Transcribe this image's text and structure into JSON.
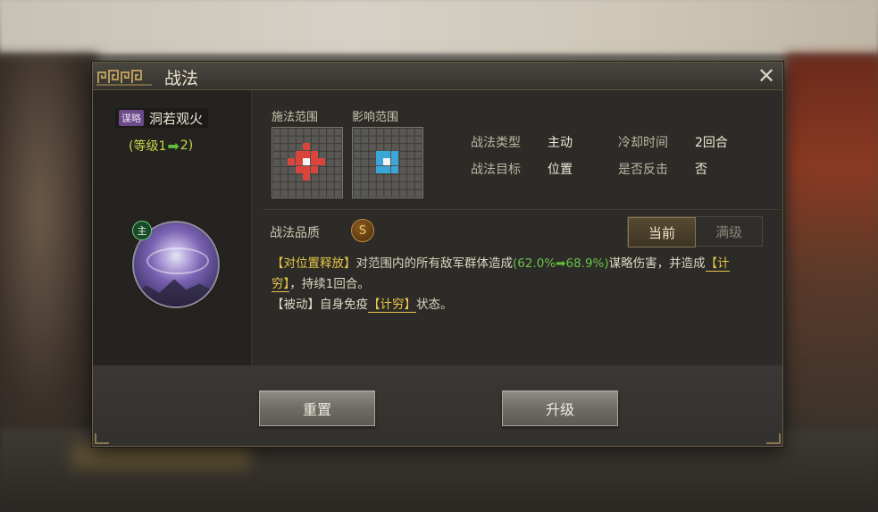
{
  "dialog": {
    "title": "战法",
    "close_symbol": "✕"
  },
  "skill": {
    "type_badge": "谋略",
    "name": "洞若观火",
    "level_prefix": "(等级1",
    "level_arrow": "➡",
    "level_suffix": "2)",
    "role_badge": "主"
  },
  "range": {
    "cast_label": "施法范围",
    "effect_label": "影响范围"
  },
  "stats": {
    "type_label": "战法类型",
    "type_value": "主动",
    "target_label": "战法目标",
    "target_value": "位置",
    "cooldown_label": "冷却时间",
    "cooldown_value": "2回合",
    "counter_label": "是否反击",
    "counter_value": "否"
  },
  "quality": {
    "label": "战法品质",
    "grade": "S"
  },
  "toggle": {
    "current": "当前",
    "max": "满级"
  },
  "description": {
    "p1_tag": "【对位置释放】",
    "p1_text_a": "对范围内的所有敌军群体造成",
    "p1_open": "(",
    "p1_from": "62.0%",
    "p1_arrow": "➡",
    "p1_to": "68.9%",
    "p1_close": ")",
    "p1_text_b": "谋略伤害，并造成",
    "p1_kw": "【计穷】",
    "p1_text_c": "，持续1回合。",
    "p2_tag": "【被动】",
    "p2_text_a": "自身免疫",
    "p2_kw": "【计穷】",
    "p2_text_b": "状态。"
  },
  "buttons": {
    "reset": "重置",
    "upgrade": "升级"
  },
  "colors": {
    "accent_gold": "#e8c64a",
    "accent_green": "#6cc24a",
    "cast_range_red": "#d9443c",
    "effect_range_cyan": "#3aa7d8"
  }
}
